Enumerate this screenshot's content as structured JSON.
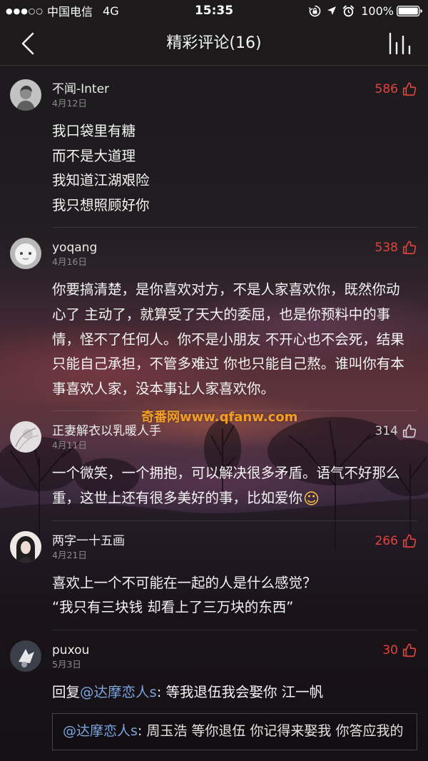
{
  "status_bar": {
    "signal": "●●●○○",
    "carrier": "中国电信",
    "network": "4G",
    "time": "15:35",
    "battery": "100%",
    "icons": [
      "orientation-lock-icon",
      "location-icon",
      "alarm-icon",
      "battery-icon"
    ]
  },
  "nav": {
    "back_icon": "chevron-left-icon",
    "title": "精彩评论(16)",
    "right_icon": "now-playing-icon"
  },
  "watermark": "奇番网www.qfanw.com",
  "colors": {
    "liked": "#e4433c",
    "not_liked": "#d2d2d2",
    "mention": "#7aa5de",
    "date": "#8c8c8c",
    "watermark": "#f0a026"
  },
  "comments": [
    {
      "user": "不闻-Inter",
      "date": "4月12日",
      "likes": "586",
      "liked": true,
      "lines": [
        "我口袋里有糖",
        "而不是大道理",
        "我知道江湖艰险",
        "我只想照顾好你"
      ]
    },
    {
      "user": "yoqang",
      "date": "4月16日",
      "likes": "538",
      "liked": true,
      "lines": [
        "你要搞清楚，是你喜欢对方，不是人家喜欢你，既然你动",
        "心了 主动了，就算受了天大的委屈，也是你预料中的事",
        "情，怪不了任何人。你不是小朋友 不开心也不会死，结果",
        "只能自己承担，不管多难过 你也只能自己熬。谁叫你有本",
        "事喜欢人家，没本事让人家喜欢你。"
      ]
    },
    {
      "user": "正妻解衣以乳暖人手",
      "date": "4月11日",
      "likes": "314",
      "liked": false,
      "lines": [
        "一个微笑，一个拥抱，可以解决很多矛盾。语气不好那么",
        "重，这世上还有很多美好的事，比如爱你"
      ],
      "emoji": "☺"
    },
    {
      "user": "两字一十五画",
      "date": "4月21日",
      "likes": "266",
      "liked": true,
      "lines": [
        "喜欢上一个不可能在一起的人是什么感觉？",
        "“我只有三块钱 却看上了三万块的东西”"
      ]
    },
    {
      "user": "puxou",
      "date": "5月3日",
      "likes": "30",
      "liked": true,
      "reply": {
        "prefix": "回复",
        "mention": "@达摩恋人s",
        "text": ": 等我退伍我会娶你 江一帆"
      },
      "quote": {
        "mention": "@达摩恋人s",
        "text": ": 周玉浩 等你退伍 你记得来娶我 你答应我的"
      }
    }
  ]
}
